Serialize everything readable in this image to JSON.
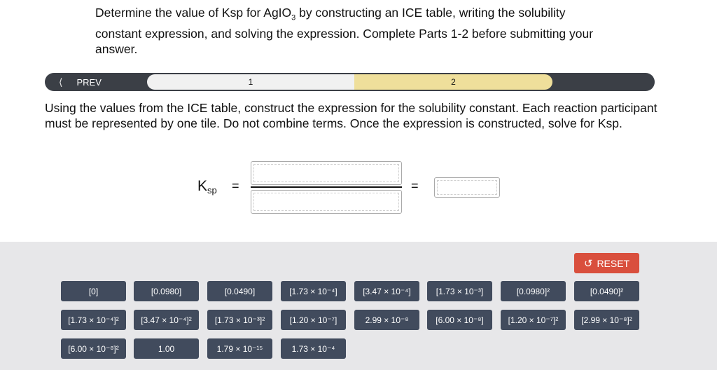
{
  "intro": {
    "text_before": "Determine the value of Ksp for AgIO",
    "subscript": "3",
    "text_after": " by constructing an ICE table, writing the solubility constant expression, and solving the expression. Complete Parts 1-2 before submitting your answer."
  },
  "nav": {
    "prev_label": "PREV",
    "steps": [
      "1",
      "2"
    ],
    "active_step": "2"
  },
  "question": "Using the values from the ICE table, construct the expression for the solubility constant. Each reaction participant must be represented by one tile. Do not combine terms. Once the expression is constructed, solve for Ksp.",
  "expression": {
    "ksp_main": "K",
    "ksp_sub": "sp",
    "equals": "="
  },
  "tray": {
    "reset_label": "RESET",
    "tiles": [
      "[0]",
      "[0.0980]",
      "[0.0490]",
      "[1.73 × 10⁻⁴]",
      "[3.47 × 10⁻⁴]",
      "[1.73 × 10⁻³]",
      "[0.0980]²",
      "[0.0490]²",
      "[1.73 × 10⁻⁴]²",
      "[3.47 × 10⁻⁴]²",
      "[1.73 × 10⁻³]²",
      "[1.20 × 10⁻⁷]",
      "2.99 × 10⁻⁸",
      "[6.00 × 10⁻⁸]",
      "[1.20 × 10⁻⁷]²",
      "[2.99 × 10⁻⁸]²",
      "[6.00 × 10⁻⁸]²",
      "1.00",
      "1.79 × 10⁻¹⁵",
      "1.73 × 10⁻⁴"
    ]
  },
  "colors": {
    "nav_bar": "#3b3f46",
    "active_step": "#efdf9b",
    "tile": "#414b5d",
    "reset": "#d94f3d",
    "tray": "#e7e7e9"
  }
}
